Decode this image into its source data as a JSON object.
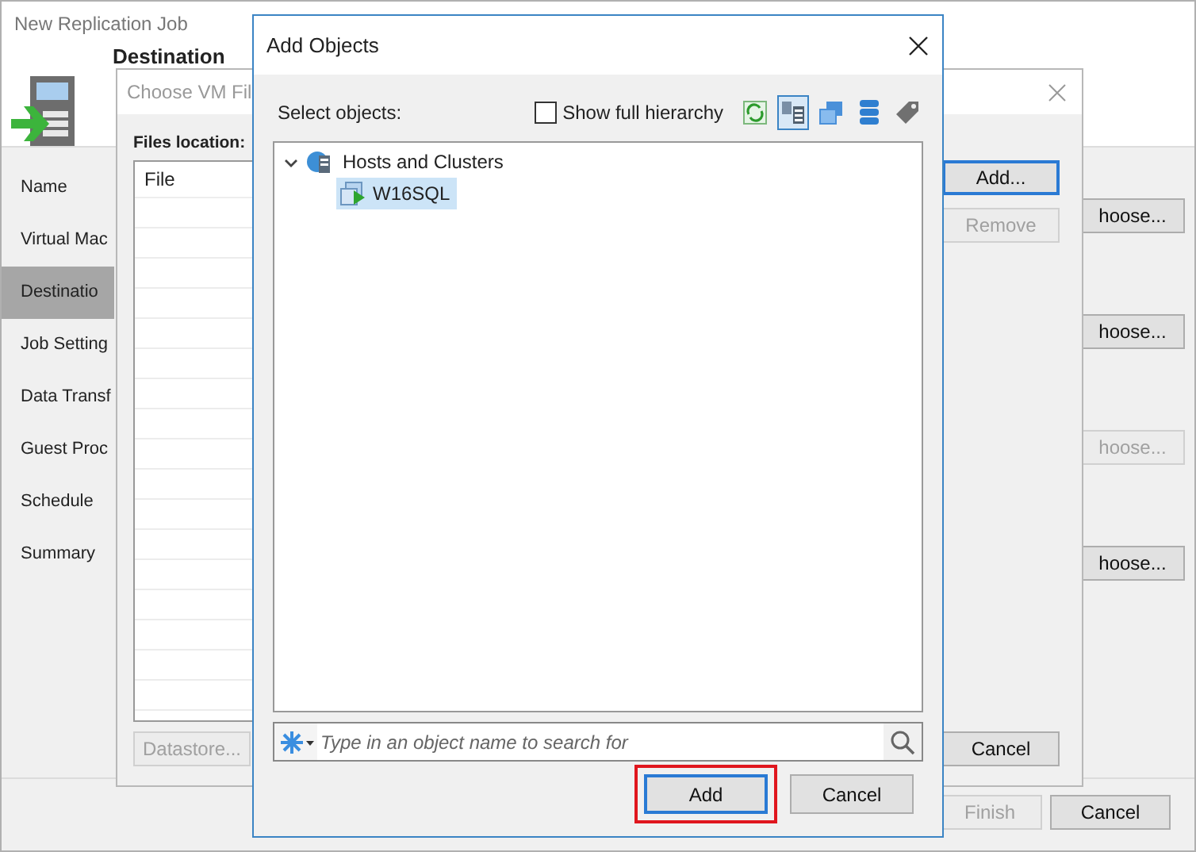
{
  "wizard": {
    "title": "New Replication Job",
    "heading": "Destination",
    "steps": [
      {
        "label": "Name",
        "selected": false
      },
      {
        "label": "Virtual Mac",
        "selected": false
      },
      {
        "label": "Destinatio",
        "selected": true
      },
      {
        "label": "Job Setting",
        "selected": false
      },
      {
        "label": "Data Transf",
        "selected": false
      },
      {
        "label": "Guest Proc",
        "selected": false
      },
      {
        "label": "Schedule",
        "selected": false
      },
      {
        "label": "Summary",
        "selected": false
      }
    ],
    "choose_buttons": [
      {
        "label": "hoose...",
        "disabled": false
      },
      {
        "label": "hoose...",
        "disabled": false
      },
      {
        "label": "hoose...",
        "disabled": true
      },
      {
        "label": "hoose...",
        "disabled": false
      }
    ],
    "buttons": [
      {
        "label": "Finish",
        "disabled": true
      },
      {
        "label": "Cancel",
        "disabled": false
      }
    ]
  },
  "files_dialog": {
    "title": "Choose VM Fil",
    "location_label": "Files location:",
    "column": "File",
    "buttons": [
      {
        "kind": "datastore",
        "label": "Datastore...",
        "disabled": true,
        "focused": false
      },
      {
        "kind": "add",
        "label": "Add...",
        "disabled": false,
        "focused": true
      },
      {
        "kind": "remove",
        "label": "Remove",
        "disabled": true,
        "focused": false
      },
      {
        "kind": "cancel",
        "label": "Cancel",
        "disabled": false,
        "focused": false
      }
    ]
  },
  "add_objects": {
    "title": "Add Objects",
    "select_label": "Select objects:",
    "show_full_hierarchy": {
      "label": "Show full hierarchy",
      "checked": false
    },
    "views": [
      {
        "kind": "refresh",
        "selected": false
      },
      {
        "kind": "hosts",
        "selected": true
      },
      {
        "kind": "vms",
        "selected": false
      },
      {
        "kind": "datastores",
        "selected": false
      },
      {
        "kind": "tags",
        "selected": false
      }
    ],
    "tree": [
      {
        "label": "Hosts and Clusters",
        "expanded": true,
        "children": [
          {
            "label": "W16SQL",
            "selected": true
          }
        ]
      }
    ],
    "search": {
      "placeholder": "Type in an object name to search for"
    },
    "buttons": [
      {
        "label": "Add",
        "focused": true,
        "highlighted": true
      },
      {
        "label": "Cancel",
        "focused": false,
        "highlighted": false
      }
    ]
  }
}
